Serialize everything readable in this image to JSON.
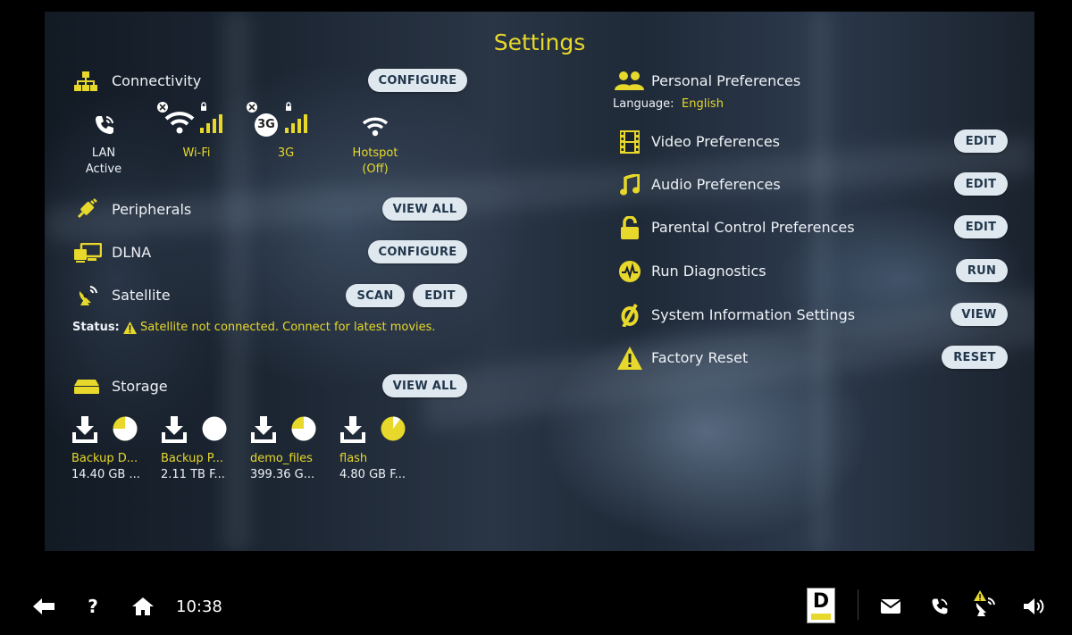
{
  "title": "Settings",
  "connectivity": {
    "label": "Connectivity",
    "button": "CONFIGURE",
    "items": [
      {
        "icon": "phone-icon",
        "name": "LAN",
        "status": "Active"
      },
      {
        "icon": "wifi-icon",
        "name": "Wi-Fi",
        "status": ""
      },
      {
        "icon": "3g-icon",
        "name": "3G",
        "status": "",
        "badge": "3G"
      },
      {
        "icon": "hotspot-icon",
        "name": "Hotspot",
        "status": "(Off)"
      }
    ]
  },
  "peripherals": {
    "label": "Peripherals",
    "button": "VIEW ALL"
  },
  "dlna": {
    "label": "DLNA",
    "button": "CONFIGURE"
  },
  "satellite": {
    "label": "Satellite",
    "scan": "SCAN",
    "edit": "EDIT",
    "status_label": "Status:",
    "status_text": "Satellite not connected. Connect for latest movies."
  },
  "storage": {
    "label": "Storage",
    "button": "VIEW ALL",
    "items": [
      {
        "name": "Backup D...",
        "size": "14.40 GB ...",
        "fill": 0.75
      },
      {
        "name": "Backup P...",
        "size": "2.11 TB F...",
        "fill": 1.0
      },
      {
        "name": "demo_files",
        "size": "399.36 G...",
        "fill": 0.75
      },
      {
        "name": "flash",
        "size": "4.80 GB F...",
        "fill": 0.1
      }
    ]
  },
  "personal": {
    "label": "Personal Preferences",
    "language_label": "Language:",
    "language_value": "English"
  },
  "right_items": [
    {
      "icon": "film-icon",
      "label": "Video Preferences",
      "button": "EDIT"
    },
    {
      "icon": "music-note-icon",
      "label": "Audio Preferences",
      "button": "EDIT"
    },
    {
      "icon": "lock-icon",
      "label": "Parental Control Preferences",
      "button": "EDIT"
    },
    {
      "icon": "pulse-icon",
      "label": "Run Diagnostics",
      "button": "RUN"
    },
    {
      "icon": "system-info-icon",
      "label": "System Information Settings",
      "button": "VIEW"
    },
    {
      "icon": "warning-icon",
      "label": "Factory Reset",
      "button": "RESET"
    }
  ],
  "taskbar": {
    "time": "10:38",
    "logo_text": "D"
  },
  "colors": {
    "accent": "#e7d82b",
    "button_bg": "#dfe8ef",
    "button_text": "#22374c"
  }
}
